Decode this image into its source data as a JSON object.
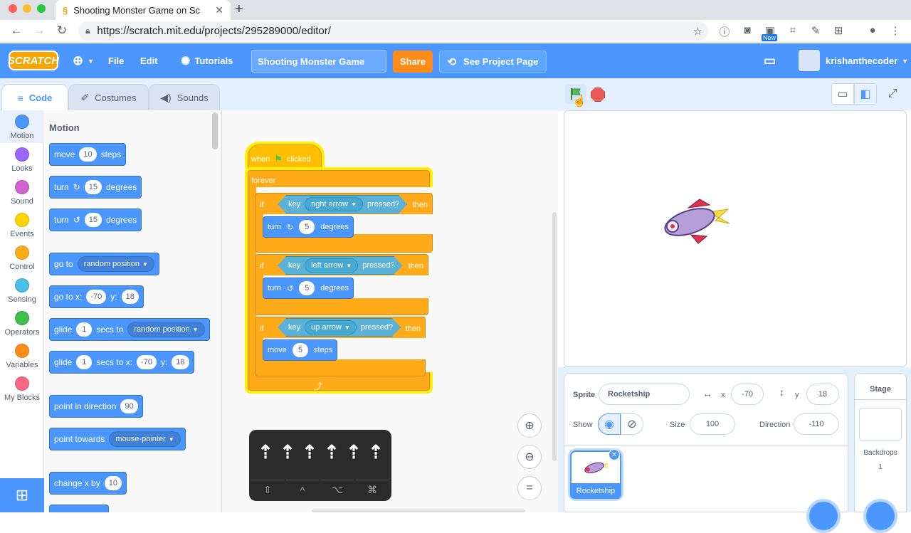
{
  "browser": {
    "tab_title": "Shooting Monster Game on Sc",
    "url": "https://scratch.mit.edu/projects/295289000/editor/",
    "new_badge": "New"
  },
  "menubar": {
    "logo": "SCRATCH",
    "file": "File",
    "edit": "Edit",
    "tutorials": "Tutorials",
    "project_title": "Shooting Monster Game",
    "share": "Share",
    "see_project_page": "See Project Page",
    "username": "krishanthecoder"
  },
  "editor_tabs": [
    "Code",
    "Costumes",
    "Sounds"
  ],
  "categories": [
    {
      "label": "Motion",
      "color": "#4c97ff"
    },
    {
      "label": "Looks",
      "color": "#9966ff"
    },
    {
      "label": "Sound",
      "color": "#cf63cf"
    },
    {
      "label": "Events",
      "color": "#ffd500"
    },
    {
      "label": "Control",
      "color": "#ffab19"
    },
    {
      "label": "Sensing",
      "color": "#4cbfe6"
    },
    {
      "label": "Operators",
      "color": "#40bf4a"
    },
    {
      "label": "Variables",
      "color": "#ff8c1a"
    },
    {
      "label": "My Blocks",
      "color": "#ff6680"
    }
  ],
  "palette": {
    "heading": "Motion",
    "move": {
      "a": "move",
      "v": "10",
      "b": "steps"
    },
    "turn_right": {
      "a": "turn",
      "v": "15",
      "b": "degrees"
    },
    "turn_left": {
      "a": "turn",
      "v": "15",
      "b": "degrees"
    },
    "goto": {
      "a": "go to",
      "dd": "random position"
    },
    "goto_xy": {
      "a": "go to x:",
      "x": "-70",
      "b": "y:",
      "y": "18"
    },
    "glide": {
      "a": "glide",
      "v": "1",
      "b": "secs to",
      "dd": "random position"
    },
    "glide_xy": {
      "a": "glide",
      "v": "1",
      "b": "secs to x:",
      "x": "-70",
      "c": "y:",
      "y": "18"
    },
    "point_dir": {
      "a": "point in direction",
      "v": "90"
    },
    "point_towards": {
      "a": "point towards",
      "dd": "mouse-pointer"
    },
    "change_x": {
      "a": "change x by",
      "v": "10"
    }
  },
  "script": {
    "hat": {
      "a": "when",
      "b": "clicked"
    },
    "forever": "forever",
    "if_label": "if",
    "then_label": "then",
    "key_label": "key",
    "pressed_label": "pressed?",
    "keys": [
      "right arrow",
      "left arrow",
      "up arrow"
    ],
    "turn_right": {
      "a": "turn",
      "v": "5",
      "b": "degrees"
    },
    "turn_left": {
      "a": "turn",
      "v": "5",
      "b": "degrees"
    },
    "move": {
      "a": "move",
      "v": "5",
      "b": "steps"
    }
  },
  "keyboard_overlay": {
    "modifiers": [
      "⇧",
      "^",
      "⌥",
      "⌘"
    ]
  },
  "sprite_info": {
    "sprite_label": "Sprite",
    "sprite_name": "Rocketship",
    "x_label": "x",
    "x": "-70",
    "y_label": "y",
    "y": "18",
    "show_label": "Show",
    "size_label": "Size",
    "size": "100",
    "direction_label": "Direction",
    "direction": "-110",
    "thumb_name": "Rocketship"
  },
  "stage_panel": {
    "title": "Stage",
    "backdrops_label": "Backdrops",
    "backdrops_count": "1"
  }
}
